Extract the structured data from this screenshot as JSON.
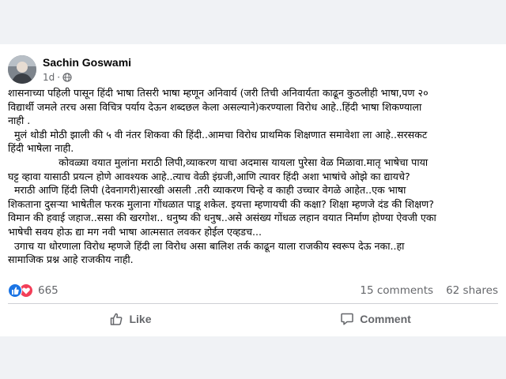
{
  "post": {
    "author": "Sachin Goswami",
    "time": "1d",
    "separator": "·",
    "privacy_icon": "globe-icon",
    "body_lines": [
      "शासनाच्या पहिली पासून हिंदी भाषा तिसरी भाषा म्हणून अनिवार्य (जरी तिची अनिवार्यता काढून कुठलीही भाषा,पण २०",
      "विद्यार्थी जमले तरच असा विचित्र पर्याय देऊन शब्दछल केला असल्याने)करण्याला विरोध आहे..हिंदी भाषा शिकण्याला",
      "नाही .",
      "  मुलं थोडी मोठी झाली की ५ वी नंतर शिकवा की हिंदी..आमचा विरोध प्राथमिक शिक्षणात समावेशा ला आहे..सरसकट",
      "हिंदी भाषेला नाही.",
      "                कोवळ्या वयात मुलांना मराठी लिपी,व्याकरण याचा अदमास यायला पुरेसा वेळ मिळावा.मातृ भाषेचा पाया",
      "घट्ट व्हावा यासाठी प्रयत्न होणे आवश्यक आहे..त्याच वेळी इंग्रजी,आणि त्यावर हिंदी अशा भाषांचे ओझे का द्यायचे?",
      "  मराठी आणि हिंदी लिपी (देवनागरी)सारखी असली .तरी व्याकरण चिन्हे व काही उच्चार वेगळे आहेत..एक भाषा",
      "शिकताना दुसऱ्या भाषेतील फरक मुलाना गोंधळात पाडू शकेल. इयत्ता म्हणायची की कक्षा? शिक्षा म्हणजे दंड की शिक्षण?",
      "विमान की हवाई जहाज..ससा की खरगोश.. धनुष्य की धनुष..असे असंख्य गोंधळ लहान वयात निर्माण होण्या ऐवजी एका",
      "भाषेची सवय होऊ द्या मग नवी भाषा आत्मसात लवकर होईल एव्हडच...",
      "  उगाच या धोरणाला विरोध म्हणजे हिंदी ला विरोध असा बालिश तर्क काढून याला राजकीय स्वरूप देऊ नका..हा",
      "सामाजिक प्रश्न आहे राजकीय नाही."
    ]
  },
  "reactions": {
    "icons": [
      "like-reaction-icon",
      "love-reaction-icon"
    ],
    "count": "665",
    "comments": "15 comments",
    "shares": "62 shares",
    "like_color": "#1b74e4",
    "love_color": "#f33e58"
  },
  "actions": {
    "like_label": "Like",
    "comment_label": "Comment"
  }
}
